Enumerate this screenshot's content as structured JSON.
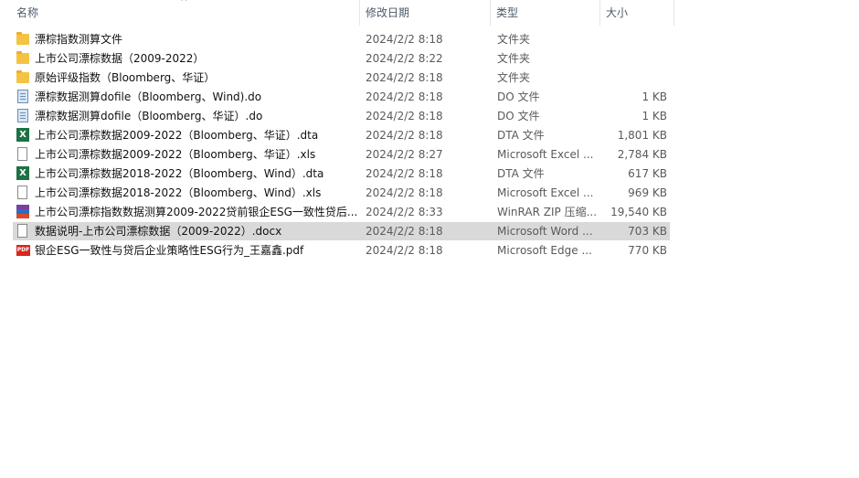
{
  "columns": {
    "name": "名称",
    "date": "修改日期",
    "type": "类型",
    "size": "大小"
  },
  "sort_indicator": "^",
  "rows": [
    {
      "icon": "folder-icon",
      "name": "漂棕指数测算文件",
      "date": "2024/2/2 8:18",
      "type": "文件夹",
      "size": ""
    },
    {
      "icon": "folder-icon",
      "name": "上市公司漂棕数据（2009-2022）",
      "date": "2024/2/2 8:22",
      "type": "文件夹",
      "size": ""
    },
    {
      "icon": "folder-icon",
      "name": "原始评级指数（Bloomberg、华证）",
      "date": "2024/2/2 8:18",
      "type": "文件夹",
      "size": ""
    },
    {
      "icon": "do-file-icon",
      "name": "漂棕数据测算dofile（Bloomberg、Wind).do",
      "date": "2024/2/2 8:18",
      "type": "DO 文件",
      "size": "1 KB"
    },
    {
      "icon": "do-file-icon",
      "name": "漂棕数据测算dofile（Bloomberg、华证）.do",
      "date": "2024/2/2 8:18",
      "type": "DO 文件",
      "size": "1 KB"
    },
    {
      "icon": "excel-icon",
      "name": "上市公司漂棕数据2009-2022（Bloomberg、华证）.dta",
      "date": "2024/2/2 8:18",
      "type": "DTA 文件",
      "size": "1,801 KB"
    },
    {
      "icon": "document-icon",
      "name": "上市公司漂棕数据2009-2022（Bloomberg、华证）.xls",
      "date": "2024/2/2 8:27",
      "type": "Microsoft Excel ...",
      "size": "2,784 KB"
    },
    {
      "icon": "excel-icon",
      "name": "上市公司漂棕数据2018-2022（Bloomberg、Wind）.dta",
      "date": "2024/2/2 8:18",
      "type": "DTA 文件",
      "size": "617 KB"
    },
    {
      "icon": "document-icon",
      "name": "上市公司漂棕数据2018-2022（Bloomberg、Wind）.xls",
      "date": "2024/2/2 8:18",
      "type": "Microsoft Excel ...",
      "size": "969 KB"
    },
    {
      "icon": "winrar-icon",
      "name": "上市公司漂棕指数数据测算2009-2022贷前银企ESG一致性贷后...",
      "date": "2024/2/2 8:33",
      "type": "WinRAR ZIP 压缩...",
      "size": "19,540 KB"
    },
    {
      "icon": "document-icon",
      "name": "数据说明-上市公司漂棕数据（2009-2022）.docx",
      "date": "2024/2/2 8:18",
      "type": "Microsoft Word ...",
      "size": "703 KB",
      "selected": true
    },
    {
      "icon": "pdf-icon",
      "name": "银企ESG一致性与贷后企业策略性ESG行为_王嘉鑫.pdf",
      "date": "2024/2/2 8:18",
      "type": "Microsoft Edge ...",
      "size": "770 KB"
    }
  ]
}
